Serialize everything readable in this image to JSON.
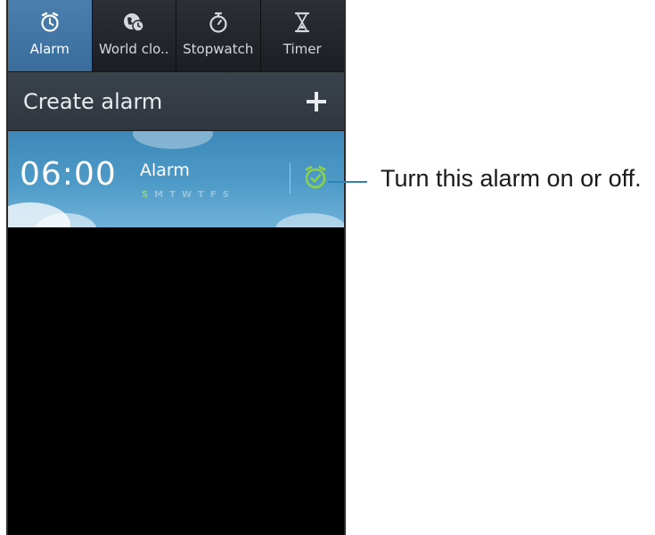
{
  "tabs": [
    {
      "label": "Alarm",
      "icon": "alarm-clock-icon",
      "active": true
    },
    {
      "label": "World clo..",
      "icon": "globe-clock-icon",
      "active": false
    },
    {
      "label": "Stopwatch",
      "icon": "stopwatch-icon",
      "active": false
    },
    {
      "label": "Timer",
      "icon": "hourglass-icon",
      "active": false
    }
  ],
  "create_row": {
    "label": "Create alarm",
    "icon": "plus-icon"
  },
  "alarm": {
    "time": "06:00",
    "name": "Alarm",
    "days": [
      "S",
      "M",
      "T",
      "W",
      "T",
      "F",
      "S"
    ],
    "toggle_icon": "alarm-on-icon",
    "toggle_color": "#8bd14a"
  },
  "callout": {
    "text": "Turn this alarm on or off."
  },
  "colors": {
    "active_tab": "#4a7fae",
    "accent_line": "#2f82b7"
  }
}
